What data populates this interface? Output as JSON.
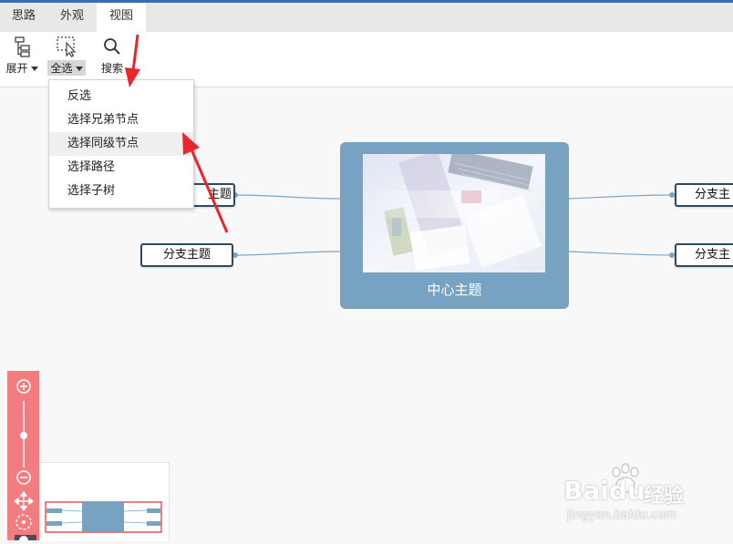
{
  "tabs": [
    {
      "label": "思路",
      "active": false
    },
    {
      "label": "外观",
      "active": false
    },
    {
      "label": "视图",
      "active": true
    }
  ],
  "toolbar": {
    "expand_label": "展开",
    "select_all_label": "全选",
    "search_label": "搜索"
  },
  "dropdown": {
    "items": [
      "反选",
      "选择兄弟节点",
      "选择同级节点",
      "选择路径",
      "选择子树"
    ],
    "hovered_index": 2
  },
  "mindmap": {
    "center_label": "中心主题",
    "branch_left_1_label": "主题",
    "branch_left_2_label": "分支主题",
    "branch_right_1_label": "分支主",
    "branch_right_2_label": "分支主"
  },
  "watermark": {
    "brand": "Baidu",
    "brand_suffix": "经验",
    "url": "jingyan.baidu.com"
  },
  "colors": {
    "accent_top": "#3a6cb3",
    "center_node": "#78a2c2",
    "branch_border": "#2f4a5c",
    "zoom_bar": "#f27d80",
    "annotation_arrow": "#e8262b"
  }
}
